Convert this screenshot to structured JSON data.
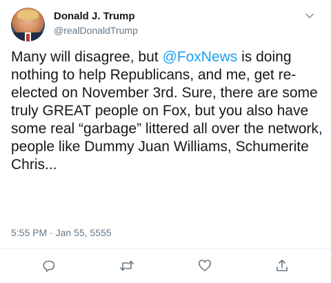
{
  "tweet": {
    "author_name": "Donald J. Trump",
    "handle": "@realDonaldTrump",
    "body_before_mention": "Many will disagree, but ",
    "mention": "@FoxNews",
    "body_after_mention": " is doing nothing to help Republicans, and me, get re-elected on November 3rd. Sure, there are some truly GREAT people on Fox, but you also have some real “garbage” littered all over the network, people like Dummy Juan Williams, Schumerite Chris...",
    "timestamp": "5:55 PM · Jan 55, 5555"
  },
  "actions": [
    {
      "name": "reply",
      "icon": "reply-icon"
    },
    {
      "name": "retweet",
      "icon": "retweet-icon"
    },
    {
      "name": "like",
      "icon": "heart-icon"
    },
    {
      "name": "share",
      "icon": "share-icon"
    }
  ],
  "colors": {
    "text": "#14171a",
    "secondary": "#657786",
    "link": "#1da1f2",
    "divider": "#e6ecf0"
  }
}
